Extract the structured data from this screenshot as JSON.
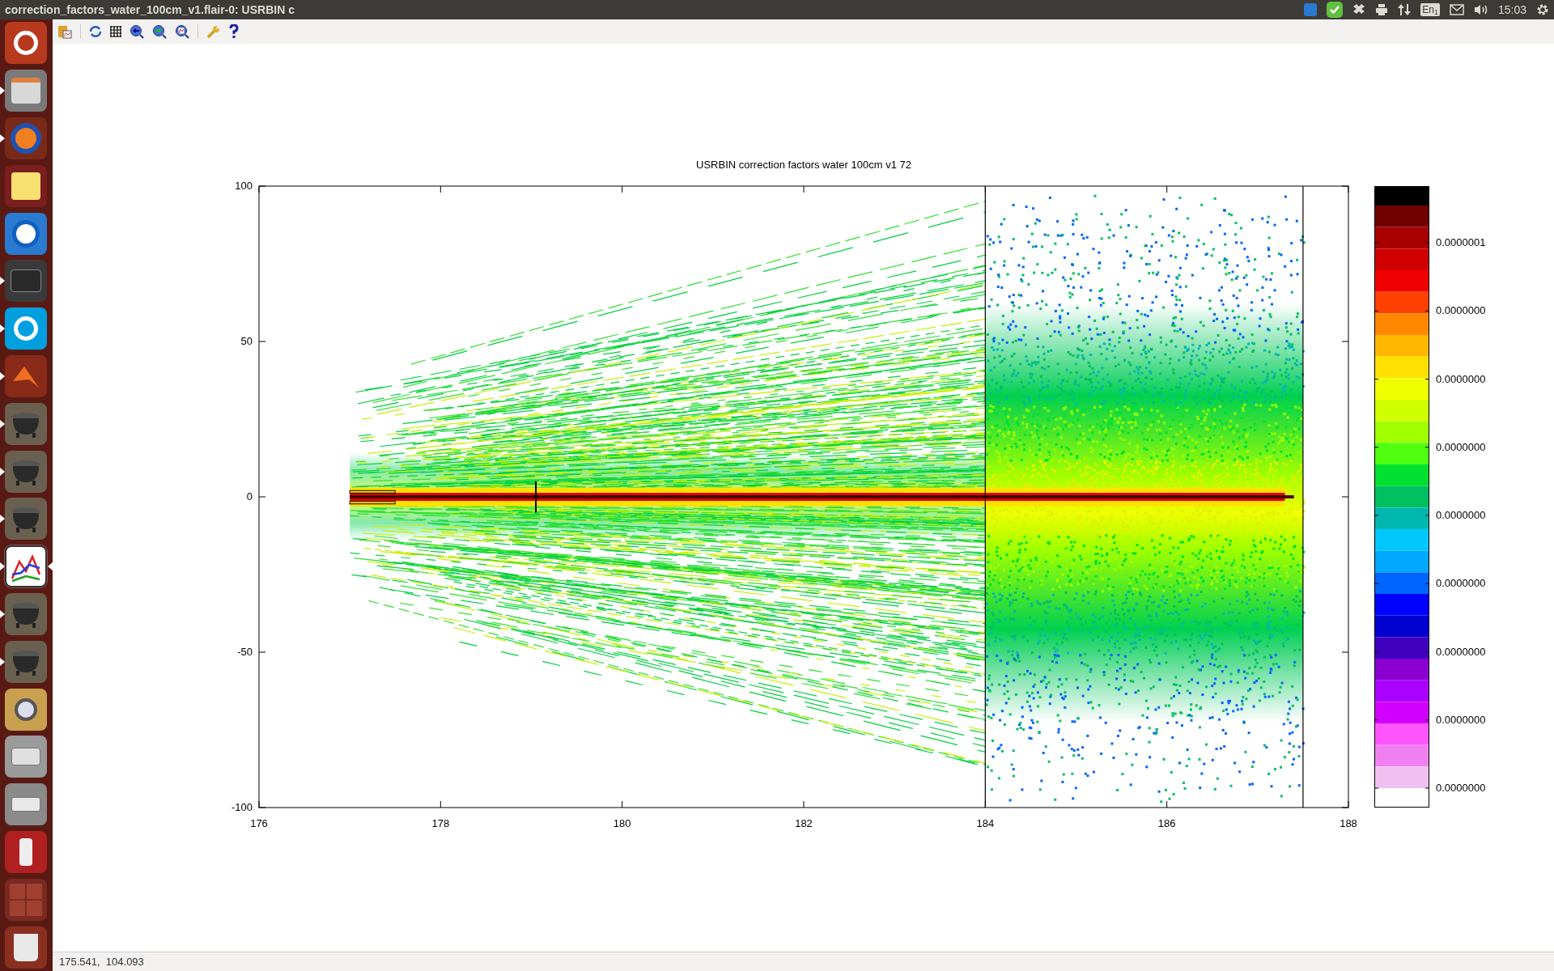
{
  "window": {
    "title": "correction_factors_water_100cm_v1.flair-0: USRBIN c"
  },
  "top_bar": {
    "keyboard": "En$_{1}$",
    "clock": "15:03"
  },
  "launcher": [
    {
      "kind": "ubuntu",
      "running": false,
      "focused": false
    },
    {
      "kind": "files",
      "running": true,
      "focused": false
    },
    {
      "kind": "browser",
      "running": true,
      "focused": false
    },
    {
      "kind": "notes",
      "running": false,
      "focused": false
    },
    {
      "kind": "remote",
      "running": false,
      "focused": false
    },
    {
      "kind": "terminal",
      "running": true,
      "focused": false
    },
    {
      "kind": "chat",
      "running": true,
      "focused": false
    },
    {
      "kind": "matlab",
      "running": true,
      "focused": false
    },
    {
      "kind": "cauldron",
      "running": true,
      "focused": false
    },
    {
      "kind": "cauldron",
      "running": true,
      "focused": false
    },
    {
      "kind": "cauldron",
      "running": true,
      "focused": false
    },
    {
      "kind": "plot",
      "running": true,
      "focused": true
    },
    {
      "kind": "cauldron",
      "running": true,
      "focused": false
    },
    {
      "kind": "cauldron",
      "running": true,
      "focused": false
    },
    {
      "kind": "viewer",
      "running": false,
      "focused": false
    },
    {
      "kind": "disk",
      "running": false,
      "focused": false
    },
    {
      "kind": "mount",
      "running": false,
      "focused": false
    },
    {
      "kind": "usb",
      "running": false,
      "focused": false
    },
    {
      "kind": "workspaces",
      "running": false,
      "focused": false
    },
    {
      "kind": "trash",
      "running": false,
      "focused": false
    }
  ],
  "plot": {
    "title": "USRBIN correction factors water 100cm v1 72",
    "xticks": [
      "176",
      "178",
      "180",
      "182",
      "184",
      "186",
      "188"
    ],
    "yticks": [
      "100",
      "50",
      "0",
      "-50",
      "-100"
    ],
    "colorbar_labels": [
      "0.0000001",
      "0.0000000",
      "0.0000000",
      "0.0000000",
      "0.0000000",
      "0.0000000",
      "0.0000000",
      "0.0000000",
      "0.0000000"
    ]
  },
  "status_bar": {
    "coordinates": "175.541,  104.093"
  }
}
